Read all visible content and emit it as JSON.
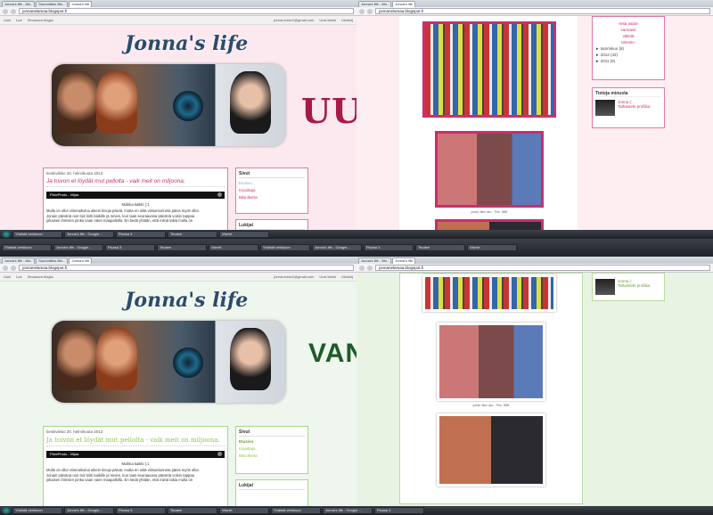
{
  "colors": {
    "new_accent": "#cc2d6f",
    "old_accent": "#8cc84b",
    "uusi_label": "#a8184a",
    "vanha_label": "#1e5a2a"
  },
  "labels": {
    "top": "UUSI",
    "bottom": "VANHA"
  },
  "blog": {
    "url": "jonnanelamaa.blogspot.fi",
    "tab_title": "Jonna's life",
    "header_script": "Jonna's life"
  },
  "browser": {
    "tabs_left": [
      "Jonna's life - Mo..",
      "Suunnittelu Blo...",
      "Jonna's life"
    ],
    "tabs_right": [
      "Jonna's life - Mo..",
      "Jonna's life"
    ],
    "bookmarks": [
      "Uusi",
      "Lue",
      "Seuraava blogia"
    ],
    "right_links": [
      "jonna.mesn1@gmail.com",
      "Uusi tekstі",
      "Uloskirj"
    ]
  },
  "post": {
    "date": "keskiviikko 20. helmikuuta 2013",
    "title": "Ja toivon et löydät mut pellolta - vaik meit on miljoona.",
    "player_label": "PixiePhoto - Viljaa",
    "body_center": "Moikka kaikki (:1",
    "body_lines": [
      "Mulla on ollut viimeaikoina aikein kivoja päiviä, mutta en niitä viitsuntunneta päivä myös ollut.",
      "Jonain päivänä oon toiz kiitti kaikille jä Ionien, kun taas seuraavana päivänä voisin tappaa",
      "jokaisen ihmisen jonka vaan näen maapallolla. En tiedä yhtään, että miinä takia mulla on"
    ]
  },
  "sidebar": {
    "pages_title": "Sivut",
    "pages": [
      "Etusivu",
      "Kirjoittaja",
      "Bikinikerta"
    ],
    "readers_title": "Lukijat",
    "archive": [
      "«Mia asiat»",
      "varmasti",
      "välistä",
      "tekstin»"
    ],
    "archive_items": [
      "► tammikuu (8)",
      "► 2012 (42)",
      "► 2011 (9)"
    ],
    "about_title": "Tietoja minusta",
    "profile_name": "Jonna (:",
    "profile_link": "Tarkastele profiilia"
  },
  "photos": {
    "caption": "joeän liikin ako · Pris: 5BB"
  },
  "taskbar": [
    "Yhdistä verkkoon",
    "Jonna's life - Google...",
    "Picasa 3",
    "Teoaee",
    "Viserrt"
  ],
  "taskbar_ext": [
    "Yhdistä verkkoon",
    "Jonna's life - Google...",
    "Picasa 3",
    "Teoaee",
    "Viserrt",
    "Yhdistä verkkoon",
    "Jonna's life - Google...",
    "Picasa 3",
    "Teoaee",
    "Viserrt"
  ]
}
